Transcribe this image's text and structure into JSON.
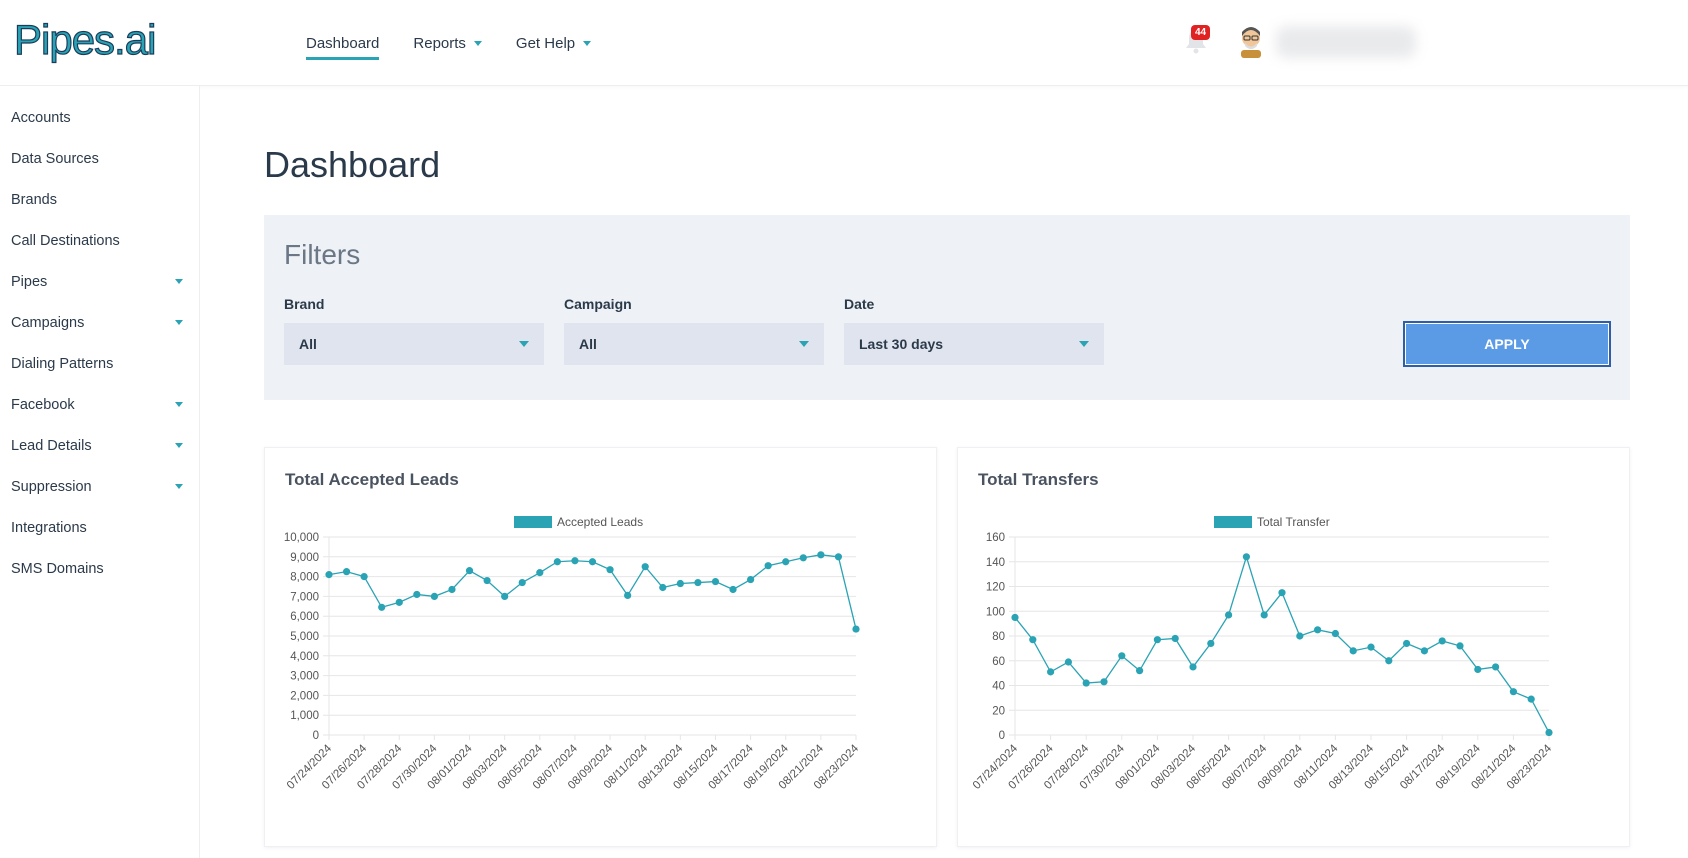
{
  "header": {
    "logo_text": "Pipes.ai",
    "nav": [
      {
        "label": "Dashboard",
        "active": true,
        "dropdown": false
      },
      {
        "label": "Reports",
        "active": false,
        "dropdown": true
      },
      {
        "label": "Get Help",
        "active": false,
        "dropdown": true
      }
    ],
    "notification_count": "44",
    "accent_color": "#2aa3b4",
    "icons": [
      "bell-icon",
      "avatar-icon"
    ]
  },
  "sidebar": {
    "items": [
      {
        "label": "Accounts",
        "dropdown": false
      },
      {
        "label": "Data Sources",
        "dropdown": false
      },
      {
        "label": "Brands",
        "dropdown": false
      },
      {
        "label": "Call Destinations",
        "dropdown": false
      },
      {
        "label": "Pipes",
        "dropdown": true
      },
      {
        "label": "Campaigns",
        "dropdown": true
      },
      {
        "label": "Dialing Patterns",
        "dropdown": false
      },
      {
        "label": "Facebook",
        "dropdown": true
      },
      {
        "label": "Lead Details",
        "dropdown": true
      },
      {
        "label": "Suppression",
        "dropdown": true
      },
      {
        "label": "Integrations",
        "dropdown": false
      },
      {
        "label": "SMS Domains",
        "dropdown": false
      }
    ]
  },
  "page": {
    "title": "Dashboard"
  },
  "filters": {
    "title": "Filters",
    "brand_label": "Brand",
    "brand_value": "All",
    "campaign_label": "Campaign",
    "campaign_value": "All",
    "date_label": "Date",
    "date_value": "Last 30 days",
    "apply_label": "APPLY"
  },
  "chart_data": [
    {
      "type": "line",
      "title": "Total Accepted Leads",
      "color": "#2aa3b4",
      "series": [
        {
          "name": "Accepted Leads",
          "values": [
            8100,
            8250,
            8000,
            6450,
            6700,
            7100,
            7000,
            7350,
            8300,
            7800,
            7000,
            7700,
            8200,
            8750,
            8800,
            8750,
            8350,
            7050,
            8500,
            7450,
            7650,
            7700,
            7750,
            7350,
            7850,
            8550,
            8750,
            8950,
            9100,
            9000,
            5350
          ]
        }
      ],
      "x": [
        "07/24/2024",
        "07/25/2024",
        "07/26/2024",
        "07/27/2024",
        "07/28/2024",
        "07/29/2024",
        "07/30/2024",
        "07/31/2024",
        "08/01/2024",
        "08/02/2024",
        "08/03/2024",
        "08/04/2024",
        "08/05/2024",
        "08/06/2024",
        "08/07/2024",
        "08/08/2024",
        "08/09/2024",
        "08/10/2024",
        "08/11/2024",
        "08/12/2024",
        "08/13/2024",
        "08/14/2024",
        "08/15/2024",
        "08/16/2024",
        "08/17/2024",
        "08/18/2024",
        "08/19/2024",
        "08/20/2024",
        "08/21/2024",
        "08/22/2024",
        "08/23/2024"
      ],
      "x_tick_labels": [
        "07/24/2024",
        "07/26/2024",
        "07/28/2024",
        "07/30/2024",
        "08/01/2024",
        "08/03/2024",
        "08/05/2024",
        "08/07/2024",
        "08/09/2024",
        "08/11/2024",
        "08/13/2024",
        "08/15/2024",
        "08/17/2024",
        "08/19/2024",
        "08/21/2024",
        "08/23/2024"
      ],
      "y_ticks": [
        "0",
        "1,000",
        "2,000",
        "3,000",
        "4,000",
        "5,000",
        "6,000",
        "7,000",
        "8,000",
        "9,000",
        "10,000"
      ],
      "ylim": [
        0,
        10000
      ],
      "grid": true,
      "legend_position": "top"
    },
    {
      "type": "line",
      "title": "Total Transfers",
      "color": "#2aa3b4",
      "series": [
        {
          "name": "Total Transfer",
          "values": [
            95,
            77,
            51,
            59,
            42,
            43,
            64,
            52,
            77,
            78,
            55,
            74,
            97,
            144,
            97,
            115,
            80,
            85,
            82,
            68,
            71,
            60,
            74,
            68,
            76,
            72,
            53,
            55,
            35,
            29,
            2
          ]
        }
      ],
      "x": [
        "07/24/2024",
        "07/25/2024",
        "07/26/2024",
        "07/27/2024",
        "07/28/2024",
        "07/29/2024",
        "07/30/2024",
        "07/31/2024",
        "08/01/2024",
        "08/02/2024",
        "08/03/2024",
        "08/04/2024",
        "08/05/2024",
        "08/06/2024",
        "08/07/2024",
        "08/08/2024",
        "08/09/2024",
        "08/10/2024",
        "08/11/2024",
        "08/12/2024",
        "08/13/2024",
        "08/14/2024",
        "08/15/2024",
        "08/16/2024",
        "08/17/2024",
        "08/18/2024",
        "08/19/2024",
        "08/20/2024",
        "08/21/2024",
        "08/22/2024",
        "08/23/2024"
      ],
      "x_tick_labels": [
        "07/24/2024",
        "07/26/2024",
        "07/28/2024",
        "07/30/2024",
        "08/01/2024",
        "08/03/2024",
        "08/05/2024",
        "08/07/2024",
        "08/09/2024",
        "08/11/2024",
        "08/13/2024",
        "08/15/2024",
        "08/17/2024",
        "08/19/2024",
        "08/21/2024",
        "08/23/2024"
      ],
      "y_ticks": [
        "0",
        "20",
        "40",
        "60",
        "80",
        "100",
        "120",
        "140",
        "160"
      ],
      "ylim": [
        0,
        160
      ],
      "grid": true,
      "legend_position": "top"
    }
  ]
}
